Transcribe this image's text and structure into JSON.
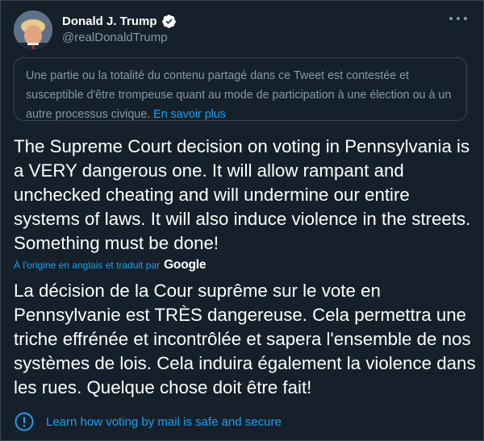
{
  "author": {
    "display_name": "Donald J. Trump",
    "handle": "@realDonaldTrump"
  },
  "notice": {
    "text": "Une partie ou la totalité du contenu partagé dans ce Tweet est contestée et susceptible d'être trompeuse quant au mode de participation à une élection ou à un autre processus civique.",
    "link": "En savoir plus"
  },
  "tweet": {
    "text": "The Supreme Court decision on voting in Pennsylvania is a VERY dangerous one. It will allow rampant and unchecked cheating and will undermine our entire systems of laws. It will also induce violence in the streets. Something must be done!"
  },
  "translation_notice": {
    "label": "À l'origine en anglais et traduit par",
    "provider": "Google"
  },
  "translation": {
    "text": "La décision de la Cour suprême sur le vote en Pennsylvanie est TRÈS dangereuse. Cela permettra une triche effrénée et incontrôlée et sapera l'ensemble de nos systèmes de lois. Cela induira également la violence dans les rues. Quelque chose doit être fait!"
  },
  "info_link": {
    "text": "Learn how voting by mail is safe and secure"
  },
  "colors": {
    "background": "#15202b",
    "border": "#38444d",
    "link": "#1da1f2",
    "secondary_text": "#8899a6"
  },
  "icons": [
    "verified-badge-icon",
    "more-options-icon",
    "info-circle-icon"
  ]
}
